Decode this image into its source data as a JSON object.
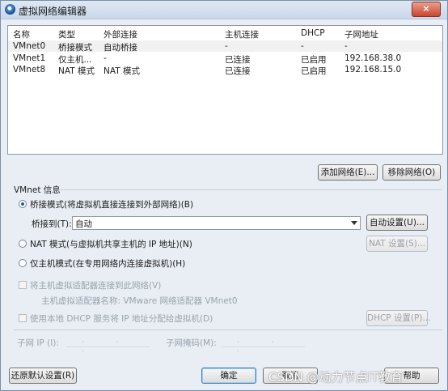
{
  "window": {
    "title": "虚拟网络编辑器",
    "close": "×"
  },
  "table": {
    "headers": [
      "名称",
      "类型",
      "外部连接",
      "主机连接",
      "DHCP",
      "子网地址"
    ],
    "rows": [
      [
        "VMnet0",
        "桥接模式",
        "自动桥接",
        "-",
        "-",
        "-"
      ],
      [
        "VMnet1",
        "仅主机...",
        "-",
        "已连接",
        "已启用",
        "192.168.38.0"
      ],
      [
        "VMnet8",
        "NAT 模式",
        "NAT 模式",
        "已连接",
        "已启用",
        "192.168.15.0"
      ]
    ]
  },
  "list_buttons": {
    "add": "添加网络(E)...",
    "remove": "移除网络(O)"
  },
  "vmnet_info": {
    "group_title": "VMnet 信息",
    "bridge_radio": "桥接模式(将虚拟机直接连接到外部网络)(B)",
    "bridge_to_label": "桥接到(T):",
    "bridge_to_value": "自动",
    "auto_settings": "自动设置(U)...",
    "nat_radio": "NAT 模式(与虚拟机共享主机的 IP 地址)(N)",
    "nat_settings": "NAT 设置(S)...",
    "hostonly_radio": "仅主机模式(在专用网络内连接虚拟机)(H)",
    "connect_adapter": "将主机虚拟适配器连接到此网络(V)",
    "adapter_name": "主机虚拟适配器名称: VMware 网络适配器 VMnet0",
    "dhcp_check": "使用本地 DHCP 服务将 IP 地址分配给虚拟机(D)",
    "dhcp_settings": "DHCP 设置(P)...",
    "subnet_ip_label": "子网 IP (I):",
    "subnet_ip_value": ". . .",
    "subnet_mask_label": "子网掩码(M):",
    "subnet_mask_value": ". . ."
  },
  "footer": {
    "restore": "还原默认设置(R)",
    "ok": "确定",
    "cancel": "取消",
    "help": "帮助"
  },
  "watermark": "CSDN @动力节点IT教育"
}
